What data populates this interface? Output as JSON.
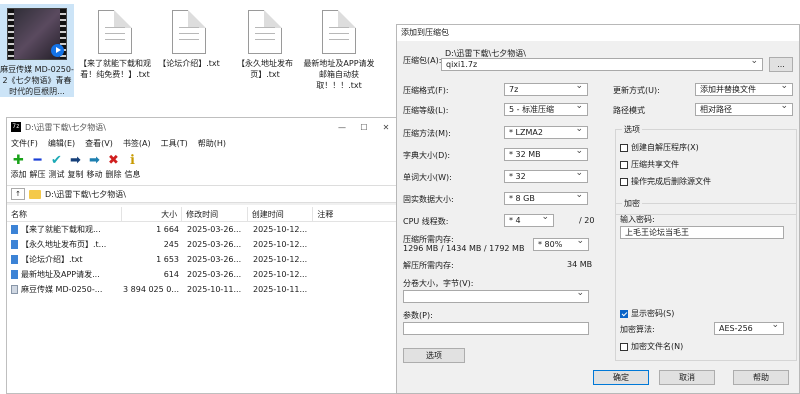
{
  "desktop": {
    "icons": [
      {
        "label": "麻豆传媒 MD-0250-2《七夕物语》青春时代的巨根阴..."
      },
      {
        "label": "【来了就能下载和观看！纯免费！】.txt"
      },
      {
        "label": "【论坛介绍】.txt"
      },
      {
        "label": "【永久地址发布页】.txt"
      },
      {
        "label": "最新地址及APP请发邮箱自动获取！！！.txt"
      }
    ]
  },
  "filemanager": {
    "title": "D:\\迅雷下载\\七夕物语\\",
    "window_controls": {
      "min": "—",
      "max": "☐",
      "close": "✕"
    },
    "menu": [
      "文件(F)",
      "编辑(E)",
      "查看(V)",
      "书签(A)",
      "工具(T)",
      "帮助(H)"
    ],
    "toolbar": [
      {
        "label": "添加",
        "glyph": "✚",
        "color": "#1aa31a"
      },
      {
        "label": "解压",
        "glyph": "━",
        "color": "#1a3fd6"
      },
      {
        "label": "测试",
        "glyph": "✔",
        "color": "#1ba9b5"
      },
      {
        "label": "复制",
        "glyph": "➡",
        "color": "#16407a"
      },
      {
        "label": "移动",
        "glyph": "➡",
        "color": "#1d7fb0"
      },
      {
        "label": "删除",
        "glyph": "✖",
        "color": "#d01f1f"
      },
      {
        "label": "信息",
        "glyph": "ℹ",
        "color": "#c79a00"
      }
    ],
    "address": "D:\\迅雷下载\\七夕物语\\",
    "columns": [
      "名称",
      "大小",
      "修改时间",
      "创建时间",
      "注释"
    ],
    "rows": [
      {
        "name": "【来了就能下载和观...",
        "size": "1 664",
        "modified": "2025-03-26...",
        "created": "2025-10-12...",
        "icon": "txt"
      },
      {
        "name": "【永久地址发布页】.t...",
        "size": "245",
        "modified": "2025-03-26...",
        "created": "2025-10-12...",
        "icon": "txt"
      },
      {
        "name": "【论坛介绍】.txt",
        "size": "1 653",
        "modified": "2025-03-26...",
        "created": "2025-10-12...",
        "icon": "txt"
      },
      {
        "name": "最新地址及APP请发...",
        "size": "614",
        "modified": "2025-03-26...",
        "created": "2025-10-12...",
        "icon": "txt"
      },
      {
        "name": "麻豆传媒 MD-0250-...",
        "size": "3 894 025 0...",
        "modified": "2025-10-11...",
        "created": "2025-10-11...",
        "icon": "video"
      }
    ]
  },
  "dialog": {
    "title": "添加到压缩包",
    "archive_label": "压缩包(A):",
    "archive_dir": "D:\\迅雷下载\\七夕物语\\",
    "archive_name": "qixi1.7z",
    "browse_label": "...",
    "format_label": "压缩格式(F):",
    "format_value": "7z",
    "level_label": "压缩等级(L):",
    "level_value": "5 - 标准压缩",
    "method_label": "压缩方法(M):",
    "method_value": "* LZMA2",
    "dict_label": "字典大小(D):",
    "dict_value": "* 32 MB",
    "word_label": "单词大小(W):",
    "word_value": "* 32",
    "solid_label": "固实数据大小:",
    "solid_value": "* 8 GB",
    "threads_label": "CPU 线程数:",
    "threads_value": "* 4",
    "threads_total": "/ 20",
    "mem_comp_label": "压缩所需内存:",
    "mem_comp_value": "1296 MB / 1434 MB / 1792 MB",
    "mem_comp_pct": "* 80%",
    "mem_decomp_label": "解压所需内存:",
    "mem_decomp_value": "34 MB",
    "split_label": "分卷大小，字节(V):",
    "params_label": "参数(P):",
    "options_button": "选项",
    "update_label": "更新方式(U):",
    "update_value": "添加并替换文件",
    "path_label": "路径模式",
    "path_value": "相对路径",
    "options_group": "选项",
    "opt_sfx": "创建自解压程序(X)",
    "opt_shared": "压缩共享文件",
    "opt_delete": "操作完成后删除源文件",
    "encrypt_group": "加密",
    "password_label": "输入密码:",
    "password_value": "上毛王论坛当毛王",
    "show_password": "显示密码(S)",
    "enc_method_label": "加密算法:",
    "enc_method_value": "AES-256",
    "enc_names": "加密文件名(N)",
    "ok": "确定",
    "cancel": "取消",
    "help": "帮助"
  }
}
